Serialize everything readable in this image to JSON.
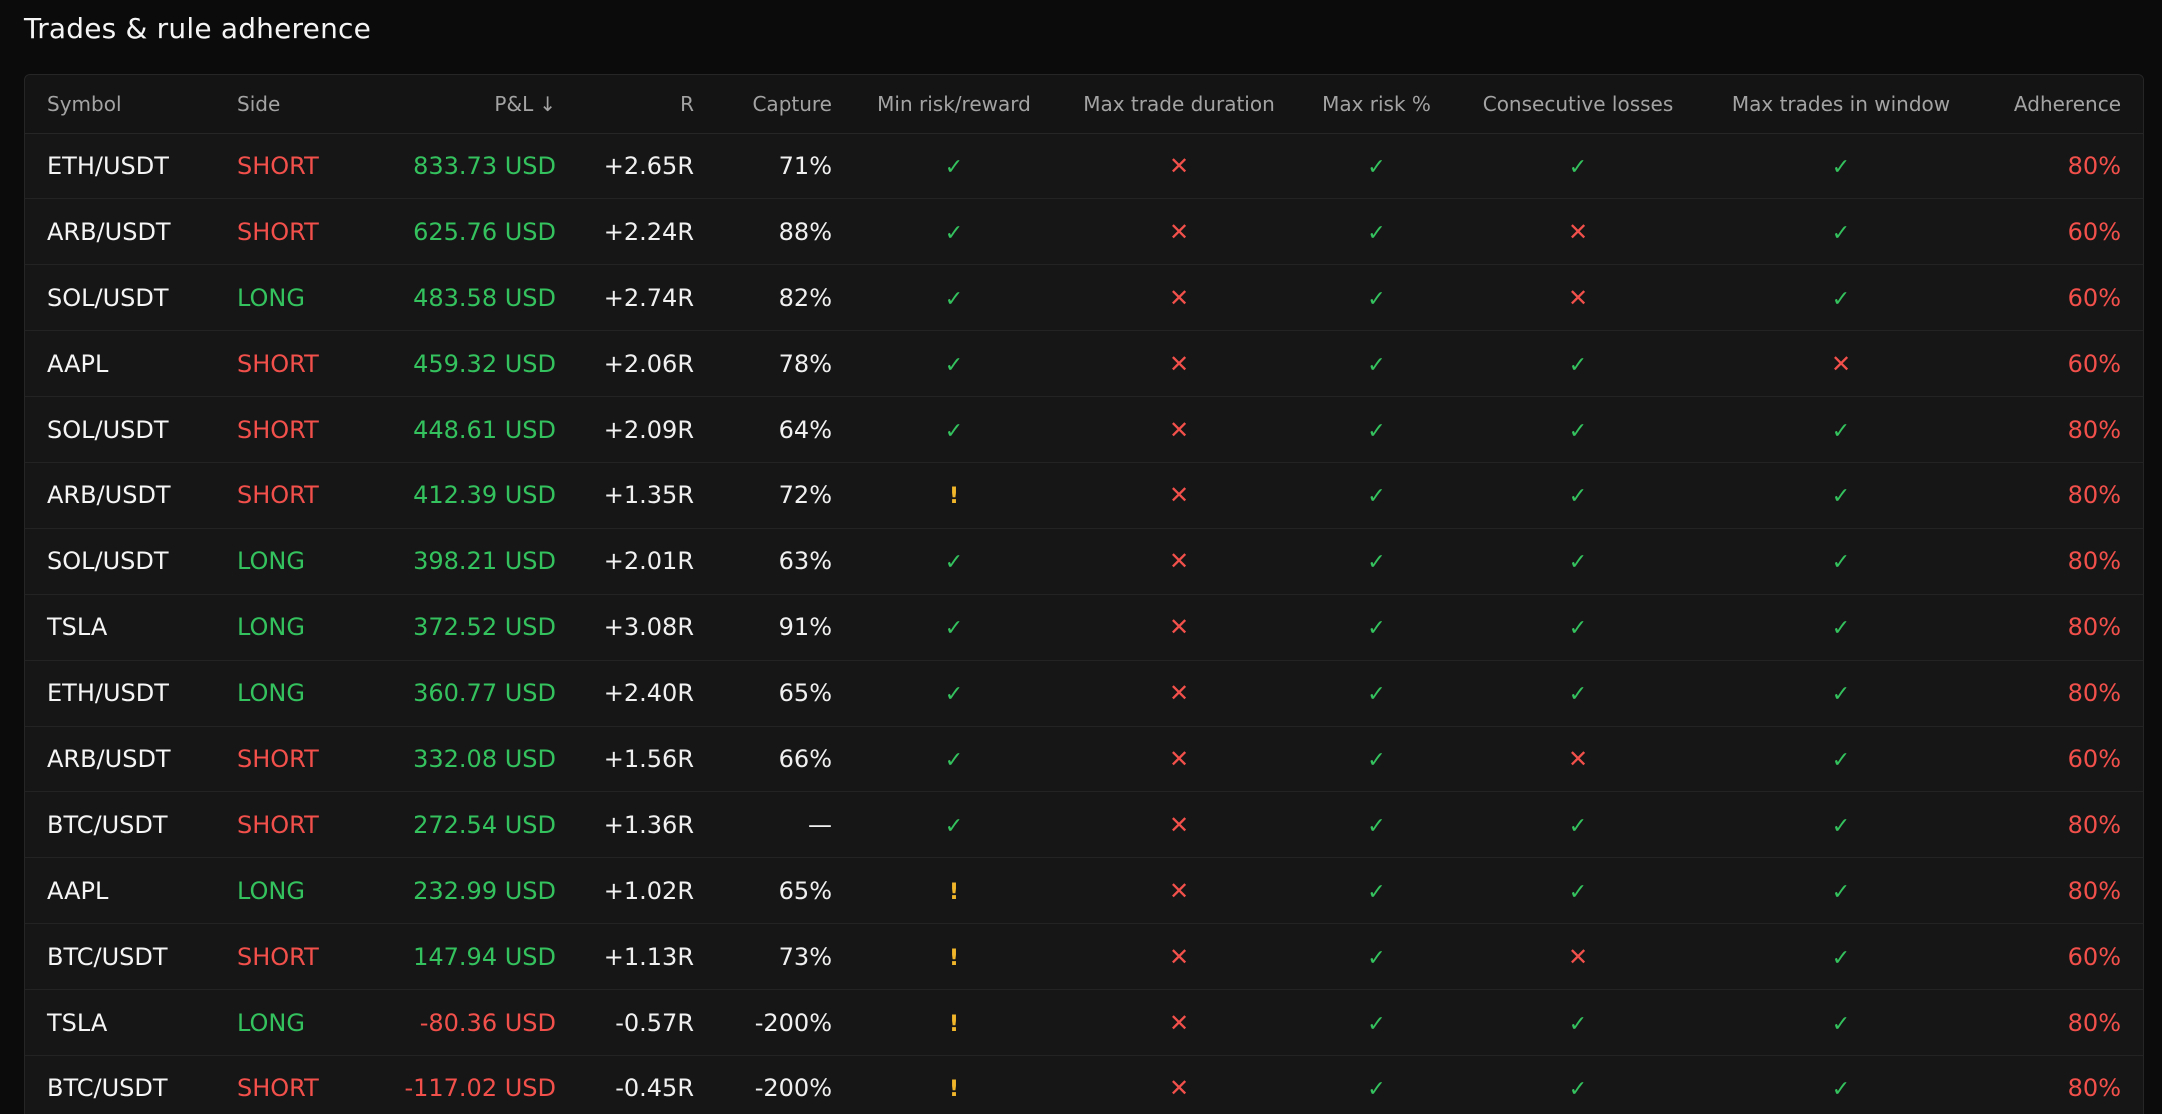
{
  "title": "Trades & rule adherence",
  "colors": {
    "positive": "#34c25e",
    "negative": "#f2504b",
    "warning": "#f2b62b",
    "adherence": "#f2504b"
  },
  "columns": {
    "symbol": "Symbol",
    "side": "Side",
    "pnl": "P&L",
    "r": "R",
    "capture": "Capture",
    "min_rr": "Min risk/reward",
    "max_duration": "Max trade duration",
    "max_risk": "Max risk %",
    "consecutive_losses": "Consecutive losses",
    "max_trades": "Max trades in window",
    "adherence": "Adherence"
  },
  "sort_icon": "arrow-down-icon",
  "sort_glyph": "↓",
  "status_glyphs": {
    "pass": "✓",
    "fail": "✕",
    "warn": "!"
  },
  "rows": [
    {
      "symbol": "ETH/USDT",
      "side": "SHORT",
      "pnl": "833.73 USD",
      "r": "+2.65R",
      "capture": "71%",
      "min_rr": "pass",
      "max_duration": "fail",
      "max_risk": "pass",
      "consecutive_losses": "pass",
      "max_trades": "pass",
      "adherence": "80%"
    },
    {
      "symbol": "ARB/USDT",
      "side": "SHORT",
      "pnl": "625.76 USD",
      "r": "+2.24R",
      "capture": "88%",
      "min_rr": "pass",
      "max_duration": "fail",
      "max_risk": "pass",
      "consecutive_losses": "fail",
      "max_trades": "pass",
      "adherence": "60%"
    },
    {
      "symbol": "SOL/USDT",
      "side": "LONG",
      "pnl": "483.58 USD",
      "r": "+2.74R",
      "capture": "82%",
      "min_rr": "pass",
      "max_duration": "fail",
      "max_risk": "pass",
      "consecutive_losses": "fail",
      "max_trades": "pass",
      "adherence": "60%"
    },
    {
      "symbol": "AAPL",
      "side": "SHORT",
      "pnl": "459.32 USD",
      "r": "+2.06R",
      "capture": "78%",
      "min_rr": "pass",
      "max_duration": "fail",
      "max_risk": "pass",
      "consecutive_losses": "pass",
      "max_trades": "fail",
      "adherence": "60%"
    },
    {
      "symbol": "SOL/USDT",
      "side": "SHORT",
      "pnl": "448.61 USD",
      "r": "+2.09R",
      "capture": "64%",
      "min_rr": "pass",
      "max_duration": "fail",
      "max_risk": "pass",
      "consecutive_losses": "pass",
      "max_trades": "pass",
      "adherence": "80%"
    },
    {
      "symbol": "ARB/USDT",
      "side": "SHORT",
      "pnl": "412.39 USD",
      "r": "+1.35R",
      "capture": "72%",
      "min_rr": "warn",
      "max_duration": "fail",
      "max_risk": "pass",
      "consecutive_losses": "pass",
      "max_trades": "pass",
      "adherence": "80%"
    },
    {
      "symbol": "SOL/USDT",
      "side": "LONG",
      "pnl": "398.21 USD",
      "r": "+2.01R",
      "capture": "63%",
      "min_rr": "pass",
      "max_duration": "fail",
      "max_risk": "pass",
      "consecutive_losses": "pass",
      "max_trades": "pass",
      "adherence": "80%"
    },
    {
      "symbol": "TSLA",
      "side": "LONG",
      "pnl": "372.52 USD",
      "r": "+3.08R",
      "capture": "91%",
      "min_rr": "pass",
      "max_duration": "fail",
      "max_risk": "pass",
      "consecutive_losses": "pass",
      "max_trades": "pass",
      "adherence": "80%"
    },
    {
      "symbol": "ETH/USDT",
      "side": "LONG",
      "pnl": "360.77 USD",
      "r": "+2.40R",
      "capture": "65%",
      "min_rr": "pass",
      "max_duration": "fail",
      "max_risk": "pass",
      "consecutive_losses": "pass",
      "max_trades": "pass",
      "adherence": "80%"
    },
    {
      "symbol": "ARB/USDT",
      "side": "SHORT",
      "pnl": "332.08 USD",
      "r": "+1.56R",
      "capture": "66%",
      "min_rr": "pass",
      "max_duration": "fail",
      "max_risk": "pass",
      "consecutive_losses": "fail",
      "max_trades": "pass",
      "adherence": "60%"
    },
    {
      "symbol": "BTC/USDT",
      "side": "SHORT",
      "pnl": "272.54 USD",
      "r": "+1.36R",
      "capture": "—",
      "min_rr": "pass",
      "max_duration": "fail",
      "max_risk": "pass",
      "consecutive_losses": "pass",
      "max_trades": "pass",
      "adherence": "80%"
    },
    {
      "symbol": "AAPL",
      "side": "LONG",
      "pnl": "232.99 USD",
      "r": "+1.02R",
      "capture": "65%",
      "min_rr": "warn",
      "max_duration": "fail",
      "max_risk": "pass",
      "consecutive_losses": "pass",
      "max_trades": "pass",
      "adherence": "80%"
    },
    {
      "symbol": "BTC/USDT",
      "side": "SHORT",
      "pnl": "147.94 USD",
      "r": "+1.13R",
      "capture": "73%",
      "min_rr": "warn",
      "max_duration": "fail",
      "max_risk": "pass",
      "consecutive_losses": "fail",
      "max_trades": "pass",
      "adherence": "60%"
    },
    {
      "symbol": "TSLA",
      "side": "LONG",
      "pnl": "-80.36 USD",
      "r": "-0.57R",
      "capture": "-200%",
      "min_rr": "warn",
      "max_duration": "fail",
      "max_risk": "pass",
      "consecutive_losses": "pass",
      "max_trades": "pass",
      "adherence": "80%"
    },
    {
      "symbol": "BTC/USDT",
      "side": "SHORT",
      "pnl": "-117.02 USD",
      "r": "-0.45R",
      "capture": "-200%",
      "min_rr": "warn",
      "max_duration": "fail",
      "max_risk": "pass",
      "consecutive_losses": "pass",
      "max_trades": "pass",
      "adherence": "80%"
    }
  ]
}
